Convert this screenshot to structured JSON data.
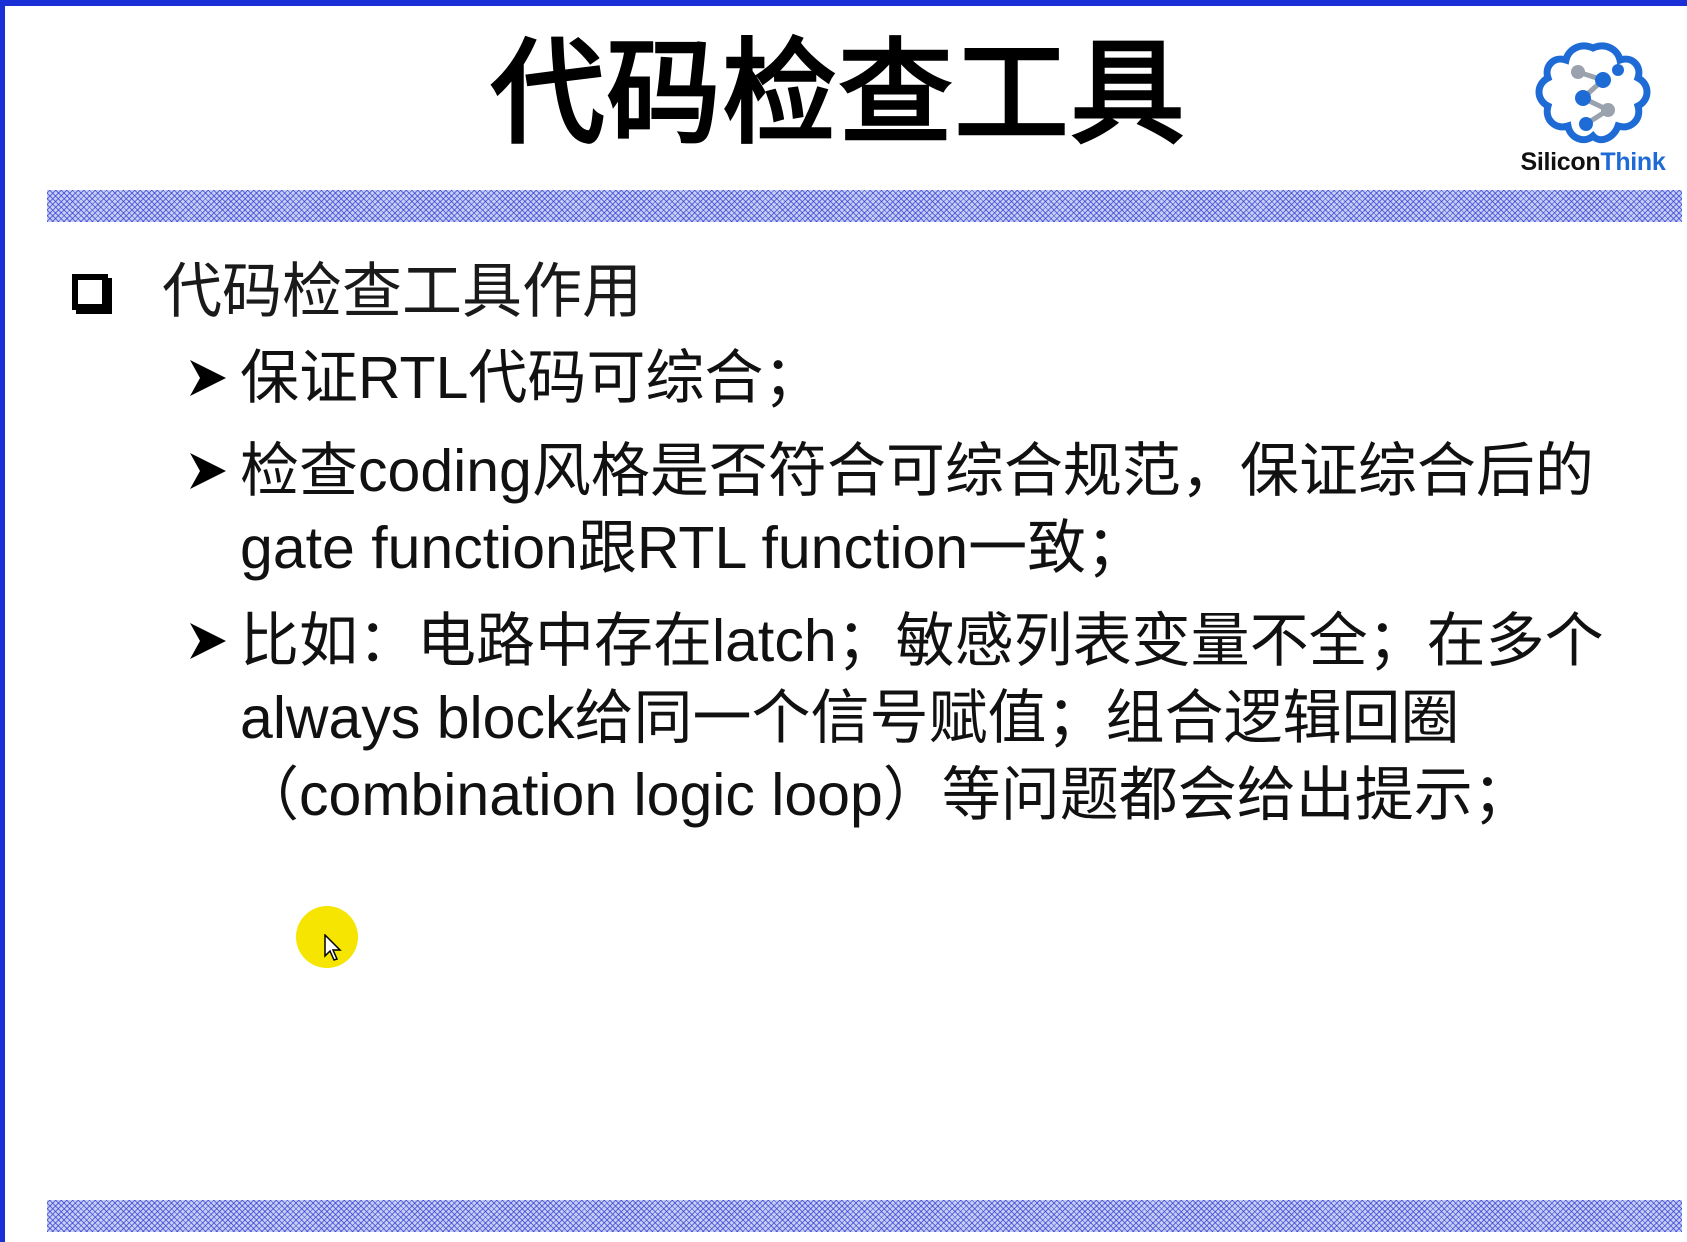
{
  "slide": {
    "title": "代码检查工具",
    "logo": {
      "brand_prefix": "Silicon",
      "brand_accent": "Think",
      "icon": "silicon-think-logo-icon",
      "accent_color": "#1e6bd6"
    },
    "frame_color": "#1b2fd6",
    "section": {
      "icon": "checkbox-bullet-icon",
      "heading": "代码检查工具作用",
      "items": [
        {
          "icon": "arrow-bullet-icon",
          "text": "保证RTL代码可综合；"
        },
        {
          "icon": "arrow-bullet-icon",
          "text": "检查coding风格是否符合可综合规范，保证综合后的gate function跟RTL function一致；"
        },
        {
          "icon": "arrow-bullet-icon",
          "text": "比如：电路中存在latch；敏感列表变量不全；在多个always block给同一个信号赋值；组合逻辑回圈（combination logic loop）等问题都会给出提示；"
        }
      ]
    },
    "cursor": {
      "icon": "mouse-pointer-icon",
      "highlight_color": "#f5e500"
    }
  }
}
